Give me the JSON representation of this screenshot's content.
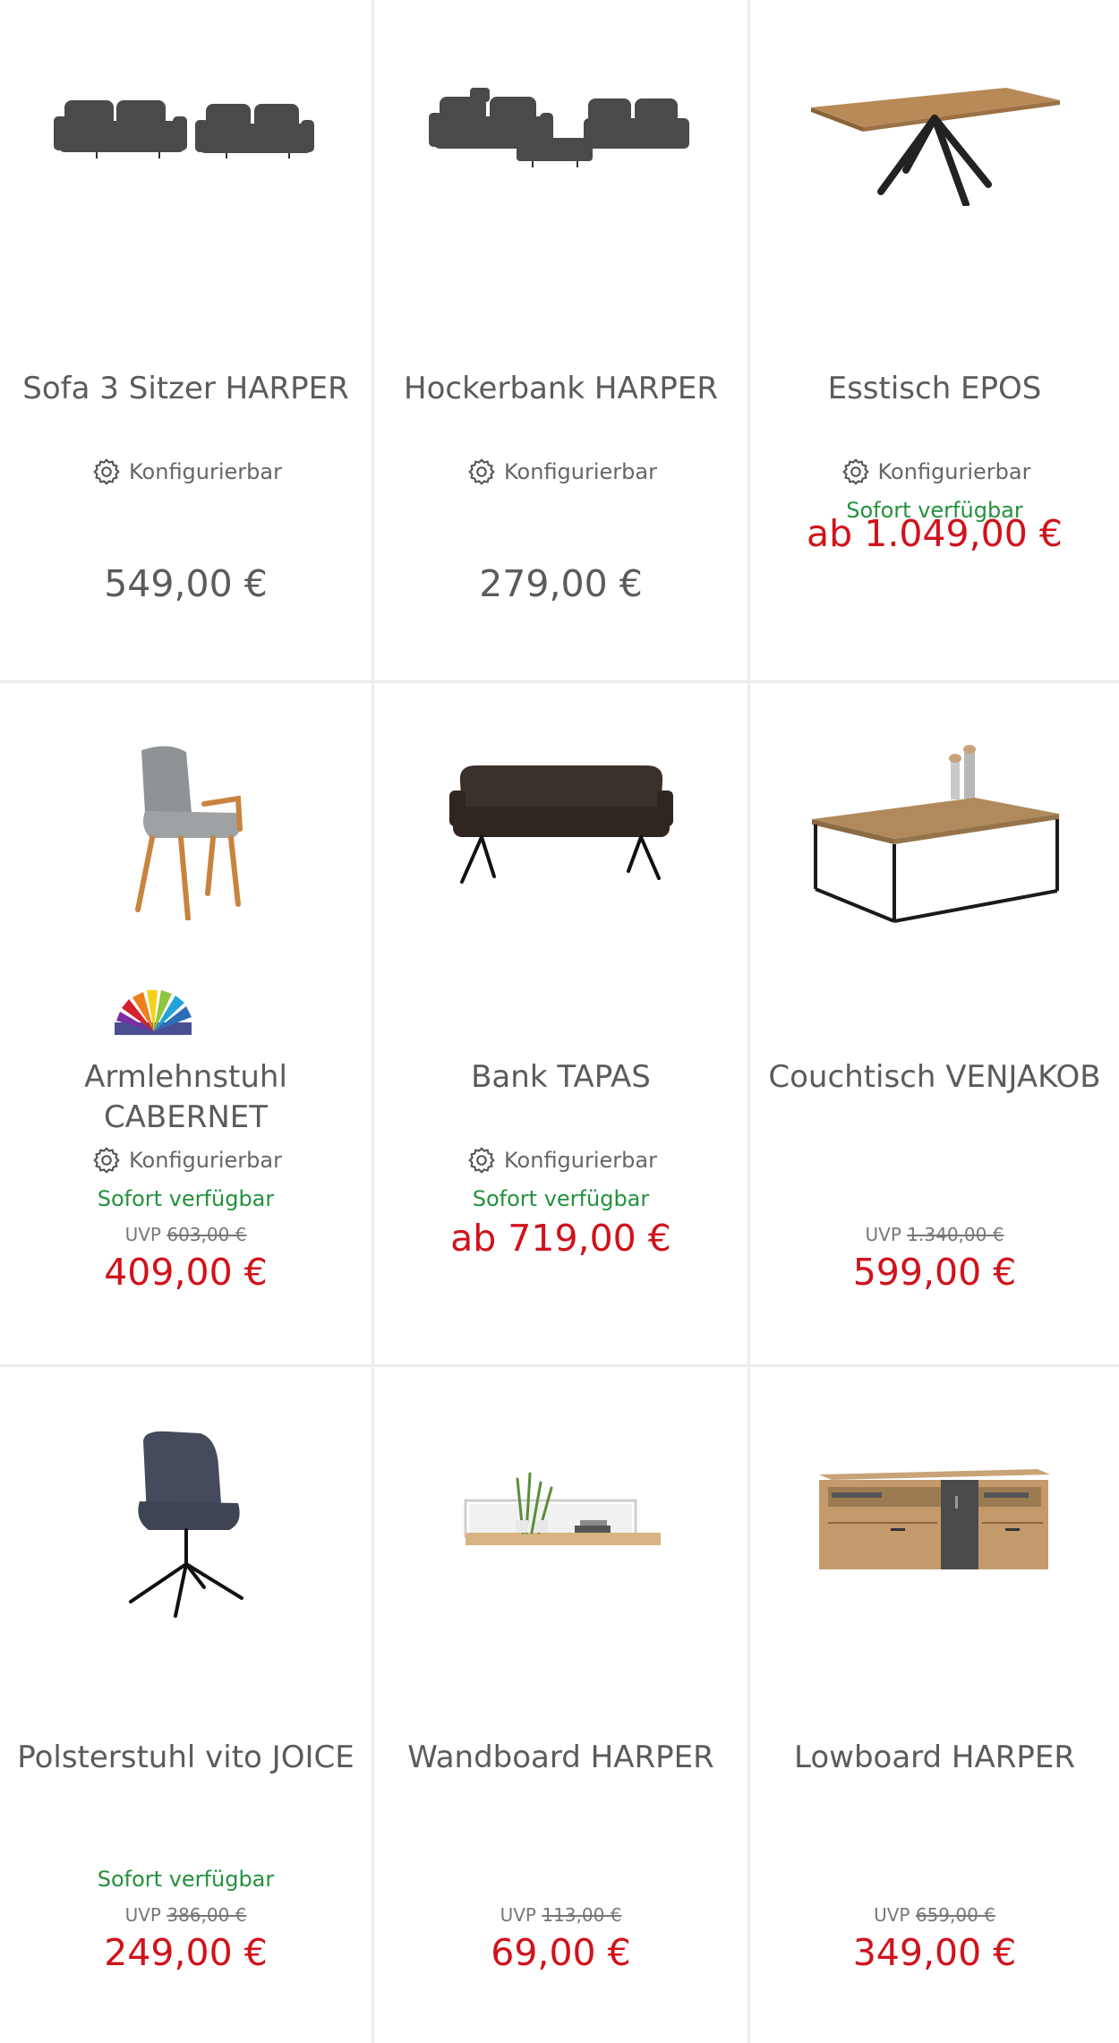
{
  "products": [
    {
      "title": "Sofa 3 Sitzer HARPER",
      "config": "Konfigurierbar",
      "stock": "",
      "uvp_label": "",
      "uvp_price": "",
      "price": "549,00 €"
    },
    {
      "title": "Hockerbank HARPER",
      "config": "Konfigurierbar",
      "stock": "",
      "uvp_label": "",
      "uvp_price": "",
      "price": "279,00 €"
    },
    {
      "title": "Esstisch EPOS",
      "config": "Konfigurierbar",
      "stock": "Sofort verfügbar",
      "uvp_label": "",
      "uvp_price": "",
      "price": "ab 1.049,00 €"
    },
    {
      "title": "Armlehnstuhl CABERNET",
      "config": "Konfigurierbar",
      "stock": "Sofort verfügbar",
      "uvp_label": "UVP",
      "uvp_price": "603,00 €",
      "price": "409,00 €"
    },
    {
      "title": "Bank TAPAS",
      "config": "Konfigurierbar",
      "stock": "Sofort verfügbar",
      "uvp_label": "",
      "uvp_price": "",
      "price": "ab 719,00 €"
    },
    {
      "title": "Couchtisch VENJAKOB",
      "config": "",
      "stock": "",
      "uvp_label": "UVP",
      "uvp_price": "1.340,00 €",
      "price": "599,00 €"
    },
    {
      "title": "Polsterstuhl vito JOICE",
      "config": "",
      "stock": "Sofort verfügbar",
      "uvp_label": "UVP",
      "uvp_price": "386,00 €",
      "price": "249,00 €"
    },
    {
      "title": "Wandboard HARPER",
      "config": "",
      "stock": "",
      "uvp_label": "UVP",
      "uvp_price": "113,00 €",
      "price": "69,00 €"
    },
    {
      "title": "Lowboard HARPER",
      "config": "",
      "stock": "",
      "uvp_label": "UVP",
      "uvp_price": "659,00 €",
      "price": "349,00 €"
    }
  ],
  "colors": {
    "sale_price": "#d0121b",
    "regular_price": "#5b5b5b",
    "stock_green": "#23913e",
    "divider": "#ececec"
  },
  "icons": {
    "config": "gear-icon",
    "color_variants": "color-fan-icon"
  }
}
